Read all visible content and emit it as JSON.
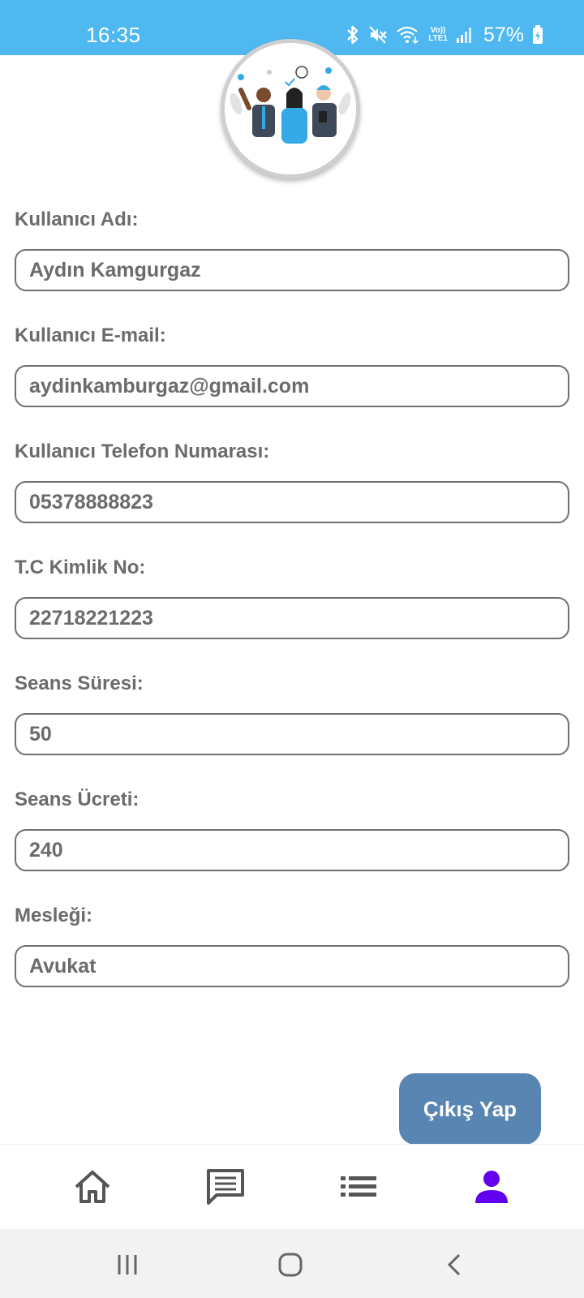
{
  "status_bar": {
    "time": "16:35",
    "volte_label_top": "Vo))",
    "volte_label_bottom": "LTE1",
    "battery_percent": "57%",
    "icons": [
      "bluetooth-icon",
      "mute-icon",
      "wifi-icon",
      "volte-icon",
      "signal-icon",
      "battery-icon"
    ]
  },
  "profile": {
    "avatar": "team-illustration"
  },
  "form": {
    "fields": [
      {
        "label": "Kullanıcı Adı:",
        "value": "Aydın Kamgurgaz"
      },
      {
        "label": "Kullanıcı E-mail:",
        "value": "aydinkamburgaz@gmail.com"
      },
      {
        "label": "Kullanıcı Telefon Numarası:",
        "value": "05378888823"
      },
      {
        "label": "T.C Kimlik No:",
        "value": "22718221223"
      },
      {
        "label": "Seans Süresi:",
        "value": "50"
      },
      {
        "label": "Seans Ücreti:",
        "value": "240"
      },
      {
        "label": "Mesleği:",
        "value": "Avukat"
      }
    ]
  },
  "logout_button": {
    "label": "Çıkış Yap"
  },
  "bottom_nav": {
    "items": [
      "home-icon",
      "chat-icon",
      "list-icon",
      "profile-icon"
    ],
    "active_item": "profile-icon",
    "active_color": "#6200ee",
    "inactive_color": "#555555"
  },
  "system_nav": {
    "items": [
      "recents-icon",
      "home-circle-icon",
      "back-icon"
    ]
  },
  "colors": {
    "status_bar": "#4fb8f1",
    "button": "#5885b1",
    "text": "#6b6b6b"
  }
}
